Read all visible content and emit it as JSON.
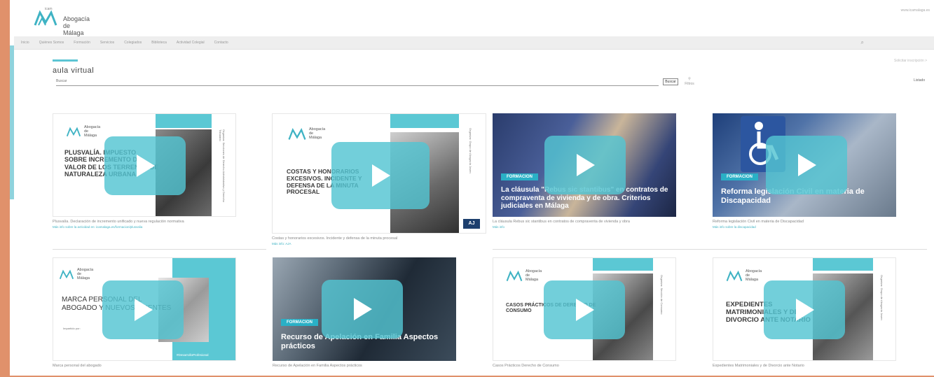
{
  "header": {
    "logo_top": "icam",
    "logo_line1": "Abogacía",
    "logo_line2": "de",
    "logo_line3": "Málaga",
    "top_right": "www.icamalaga.es"
  },
  "nav": {
    "items": [
      "Inicio",
      "Quiénes Somos",
      "Formación",
      "Servicios",
      "Colegiados",
      "Biblioteca",
      "Actividad Colegial",
      "Contacto"
    ]
  },
  "page": {
    "title": "aula virtual",
    "right_link": "Solicitar inscripción >",
    "right_link2": "Listado",
    "search_placeholder": "Buscar",
    "search_button": "Buscar",
    "filter_label": "Filtros"
  },
  "cards": [
    {
      "thumb_title": "PLUSVALÍA. IMPUESTO SOBRE INCREMENTO DE VALOR DE LOS TERRENOS DE NATURALEZA URBANA",
      "logo_lines": [
        "Abogacía",
        "de",
        "Málaga"
      ],
      "side_text": "Organiza: Secciones de Derecho Administrativo y Derecho Tributario",
      "caption": "Plusvalía. Declaración de incremento unificado y nueva regulación normativa",
      "sublink": "Más info sobre la actividad en: icamalaga.es/formacion/plusvalia"
    },
    {
      "thumb_title": "COSTAS Y HONORARIOS EXCESIVOS. INCIDENTE Y DEFENSA DE LA MINUTA PROCESAL",
      "logo_lines": [
        "Abogacía",
        "de",
        "Málaga"
      ],
      "side_text": "Organiza: Grupo de Abogacía Joven",
      "caption": "Costas y honorarios excesivos. Incidente y defensa de la minuta procesal",
      "sublink": "Más info: AJA"
    },
    {
      "badge": "FORMACION",
      "thumb_title": "La cláusula \"Rebus sic stantibus\" en contratos de compraventa de vivienda y de obra. Criterios judiciales en Málaga",
      "caption": "La cláusula Rebus sic stantibus en contratos de compraventa de vivienda y obra",
      "sublink": "Más info"
    },
    {
      "badge": "FORMACION",
      "thumb_title": "Reforma legislación Civil en materia de Discapacidad",
      "caption": "Reforma legislación Civil en materia de Discapacidad",
      "sublink": "Más info sobre la discapacidad"
    },
    {
      "thumb_title": "MARCA PERSONAL DEL ABOGADO Y NUEVOS CLIENTES",
      "logo_lines": [
        "Abogacía",
        "de",
        "Málaga"
      ],
      "hashtag": "#DesarrolloProfesional",
      "presenter": "Impartido por:",
      "caption": "Marca personal del abogado"
    },
    {
      "badge": "FORMACION",
      "thumb_title": "Recurso de Apelación en Familia Aspectos prácticos",
      "caption": "Recurso de Apelación en Familia Aspectos prácticos"
    },
    {
      "thumb_title": "CASOS PRÁCTICOS DE DERECHO DE CONSUMO",
      "logo_lines": [
        "Abogacía",
        "de",
        "Málaga"
      ],
      "side_text": "Organiza: Sección de Consumo",
      "caption": "Casos Prácticos Derecho de Consumo"
    },
    {
      "thumb_title": "EXPEDIENTES MATRIMONIALES Y DE DIVORCIO ANTE NOTARIO",
      "logo_lines": [
        "Abogacía",
        "de",
        "Málaga"
      ],
      "side_text": "Organiza: Grupo de Abogacía Joven",
      "caption": "Expedientes Matrimoniales y de Divorcio ante Notario"
    }
  ],
  "colors": {
    "teal": "#5bc8d4",
    "accent_orange": "#e0916b",
    "badge_blue": "#2ab0c6"
  }
}
